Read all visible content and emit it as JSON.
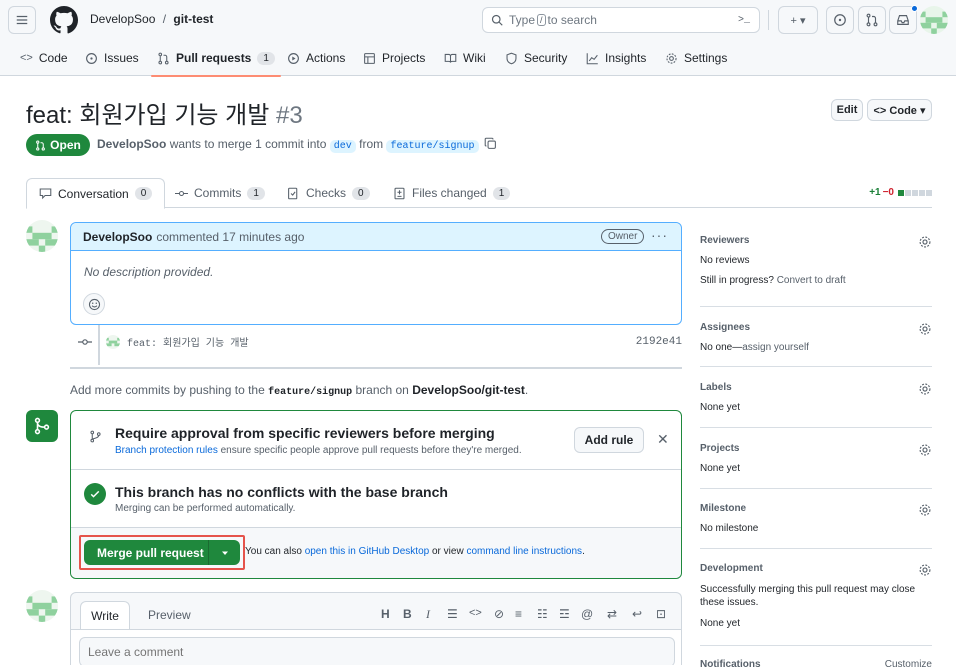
{
  "header": {
    "owner": "DevelopSoo",
    "separator": "/",
    "repo": "git-test",
    "search_prefix": "Type",
    "search_key": "/",
    "search_suffix": "to search",
    "cmd_icon": ">_",
    "plus_icon": "+ ▾"
  },
  "repo_tabs": [
    {
      "label": "Code",
      "icon": "code-icon"
    },
    {
      "label": "Issues",
      "icon": "issue-icon"
    },
    {
      "label": "Pull requests",
      "icon": "pr-icon",
      "count": "1",
      "selected": true
    },
    {
      "label": "Actions",
      "icon": "play-icon"
    },
    {
      "label": "Projects",
      "icon": "table-icon"
    },
    {
      "label": "Wiki",
      "icon": "book-icon"
    },
    {
      "label": "Security",
      "icon": "shield-icon"
    },
    {
      "label": "Insights",
      "icon": "graph-icon"
    },
    {
      "label": "Settings",
      "icon": "gear-icon"
    }
  ],
  "pr": {
    "title": "feat: 회원가입 기능 개발",
    "number": "#3",
    "edit_label": "Edit",
    "code_label": "<> Code ▾",
    "state": "Open",
    "author": "DevelopSoo",
    "meta_text": "wants to merge 1 commit into",
    "base": "dev",
    "from_text": "from",
    "head": "feature/signup"
  },
  "pr_tabs": [
    {
      "label": "Conversation",
      "count": "0"
    },
    {
      "label": "Commits",
      "count": "1"
    },
    {
      "label": "Checks",
      "count": "0"
    },
    {
      "label": "Files changed",
      "count": "1"
    }
  ],
  "diffstat": {
    "added": "+1",
    "removed": "−0"
  },
  "comment": {
    "author": "DevelopSoo",
    "action": "commented 17 minutes ago",
    "badge": "Owner",
    "body": "No description provided."
  },
  "commit": {
    "message": "feat: 회원가입 기능 개발",
    "sha": "2192e41"
  },
  "push_hint": {
    "prefix": "Add more commits by pushing to the",
    "branch": "feature/signup",
    "middle": "branch on",
    "repo": "DevelopSoo/git-test",
    "suffix": "."
  },
  "merge": {
    "approval_title": "Require approval from specific reviewers before merging",
    "rules_link": "Branch protection rules",
    "rules_text": "ensure specific people approve pull requests before they're merged.",
    "add_rule": "Add rule",
    "conflict_title": "This branch has no conflicts with the base branch",
    "conflict_sub": "Merging can be performed automatically.",
    "merge_button": "Merge pull request",
    "also_text": "You can also",
    "desktop_link": "open this in GitHub Desktop",
    "or_text": "or view",
    "cli_link": "command line instructions",
    "end": "."
  },
  "editor": {
    "write_tab": "Write",
    "preview_tab": "Preview",
    "placeholder": "Leave a comment",
    "tools": [
      "H",
      "B",
      "I"
    ]
  },
  "sidebar": {
    "reviewers": {
      "heading": "Reviewers",
      "value": "No reviews",
      "progress": "Still in progress?",
      "draft_link": "Convert to draft"
    },
    "assignees": {
      "heading": "Assignees",
      "value": "No one—",
      "assign_link": "assign yourself"
    },
    "labels": {
      "heading": "Labels",
      "value": "None yet"
    },
    "projects": {
      "heading": "Projects",
      "value": "None yet"
    },
    "milestone": {
      "heading": "Milestone",
      "value": "No milestone"
    },
    "development": {
      "heading": "Development",
      "desc": "Successfully merging this pull request may close these issues.",
      "value": "None yet"
    },
    "notifications": {
      "heading": "Notifications",
      "customize": "Customize"
    }
  },
  "colors": {
    "green": "#1f883d",
    "blue": "#0969da",
    "highlight": "#e5534b"
  }
}
